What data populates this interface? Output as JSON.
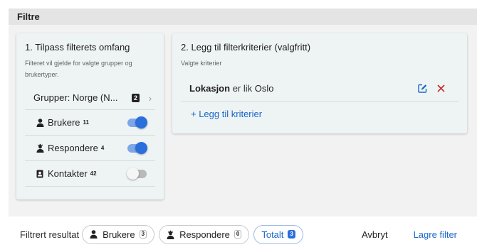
{
  "section": {
    "title": "Filtre"
  },
  "scope": {
    "title": "1. Tilpass filterets omfang",
    "subtitle": "Filteret vil gjelde for valgte grupper og brukertyper.",
    "groups": {
      "label": "Grupper: Norge (N...",
      "count": "2"
    },
    "types": [
      {
        "label": "Brukere",
        "count": "11",
        "enabled": true
      },
      {
        "label": "Respondere",
        "count": "4",
        "enabled": true
      },
      {
        "label": "Kontakter",
        "count": "42",
        "enabled": false
      }
    ]
  },
  "criteria": {
    "title": "2. Legg til filterkriterier (valgfritt)",
    "subtitle": "Valgte kriterier",
    "items": [
      {
        "field": "Lokasjon",
        "operator": "er lik",
        "value": "Oslo"
      }
    ],
    "add_label": "+ Legg til kriterier"
  },
  "footer": {
    "label": "Filtrert resultat",
    "chips": [
      {
        "label": "Brukere",
        "count": "3",
        "icon": "user-icon"
      },
      {
        "label": "Respondere",
        "count": "0",
        "icon": "responder-icon"
      },
      {
        "label": "Totalt",
        "count": "3",
        "active": true
      }
    ],
    "cancel_label": "Avbryt",
    "save_label": "Lagre filter"
  },
  "colors": {
    "accent": "#1a66c9",
    "toggle_on": "#2a6fdb",
    "card_bg": "#eef4f4",
    "danger": "#c62828"
  }
}
